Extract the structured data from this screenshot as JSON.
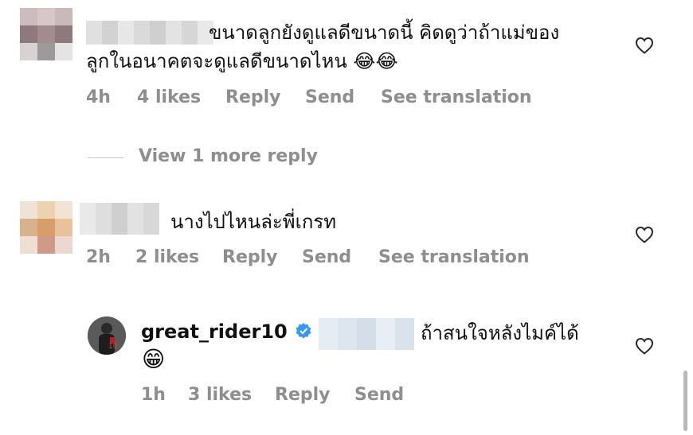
{
  "comments": [
    {
      "text_line1": "ขนาดลูกยังดูแลดีขนาดนี้ คิดดูว่าถ้าแม่ของ",
      "text_line2": "ลูกในอนาคตจะดูแลดีขนาดไหน 😂😂",
      "time": "4h",
      "likes": "4 likes",
      "reply": "Reply",
      "send": "Send",
      "translate": "See translation"
    },
    {
      "text": "นางไปไหนล่ะพี่เกรท",
      "time": "2h",
      "likes": "2 likes",
      "reply": "Reply",
      "send": "Send",
      "translate": "See translation"
    }
  ],
  "view_more": "View 1 more reply",
  "reply": {
    "username": "great_rider10",
    "verified_icon": "verified-badge-icon",
    "text_line1": "ถ้าสนใจหลังไมค์ได้",
    "text_line2": "😁",
    "time": "1h",
    "likes": "3 likes",
    "reply": "Reply",
    "send": "Send"
  },
  "colors": {
    "meta": "#8e8e8e",
    "verified": "#3897f0",
    "text": "#111111"
  }
}
